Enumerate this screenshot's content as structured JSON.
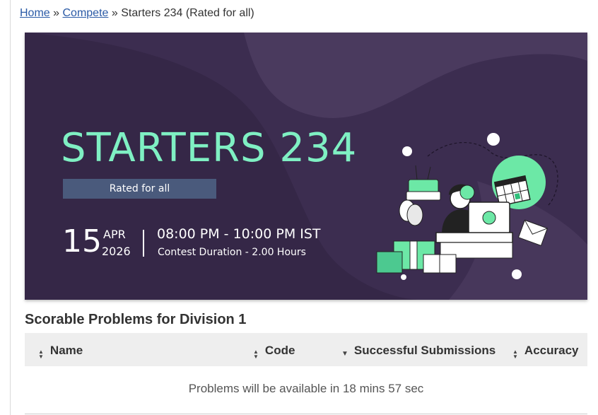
{
  "breadcrumb": {
    "home": "Home",
    "sep1": "»",
    "compete": "Compete",
    "sep2": "»",
    "current": "Starters 234 (Rated for all)"
  },
  "banner": {
    "title": "STARTERS 234",
    "badge": "Rated for all",
    "day": "15",
    "month": "APR",
    "year": "2026",
    "time": "08:00 PM - 10:00 PM IST",
    "duration": "Contest Duration - 2.00 Hours",
    "colors": {
      "background": "#3a2b4d",
      "accent": "#7ff0c3",
      "badge": "#4a5a7c"
    }
  },
  "section": {
    "heading": "Scorable Problems for Division 1"
  },
  "table": {
    "columns": [
      {
        "label": "Name",
        "sort": "both"
      },
      {
        "label": "Code",
        "sort": "both"
      },
      {
        "label": "Successful Submissions",
        "sort": "desc"
      },
      {
        "label": "Accuracy",
        "sort": "both"
      }
    ],
    "empty_message": "Problems will be available in 18 mins 57 sec"
  }
}
